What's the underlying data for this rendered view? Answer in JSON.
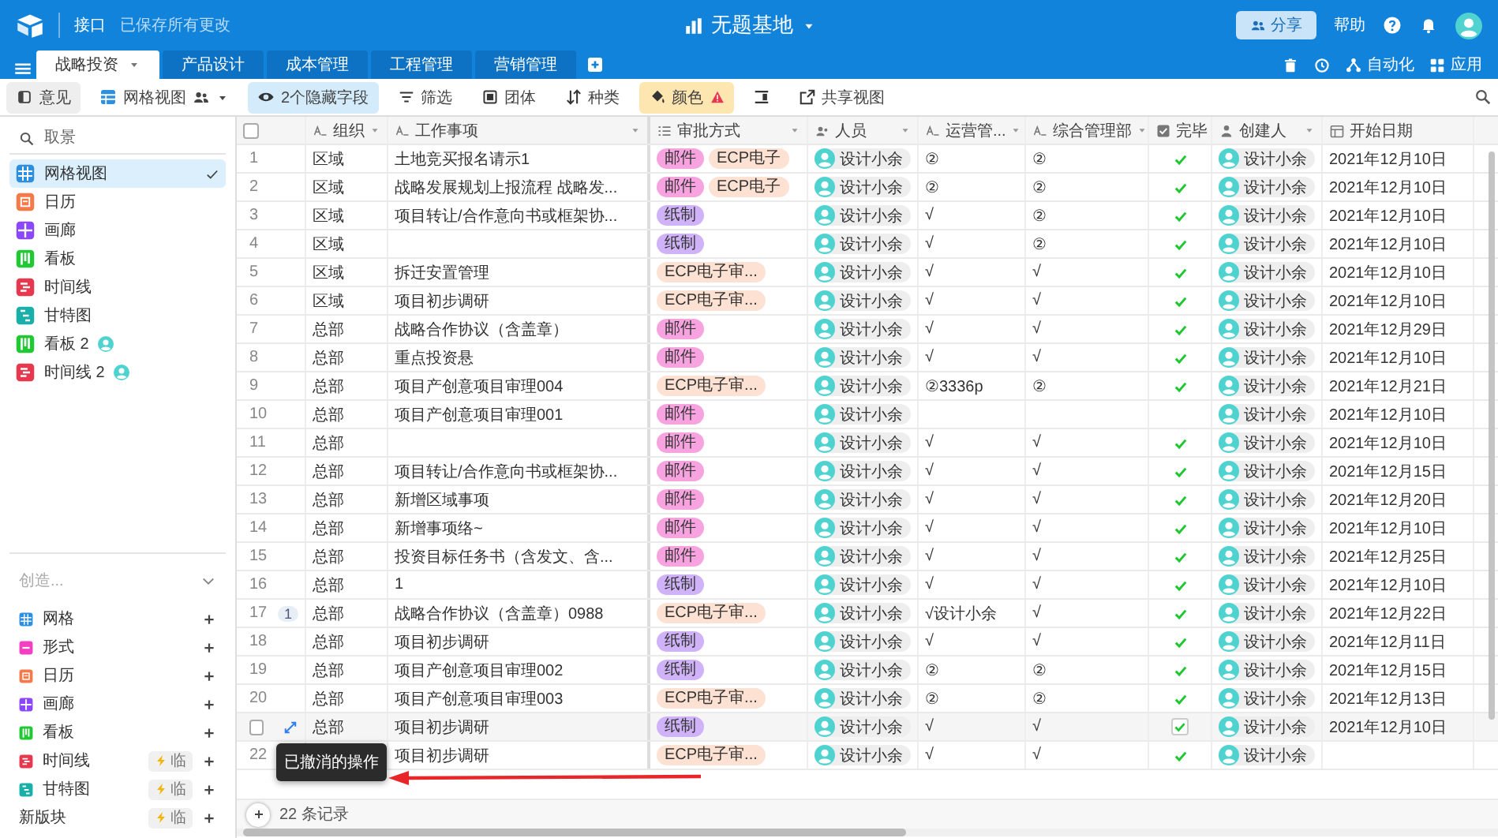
{
  "topbar": {
    "app_label": "接口",
    "save_status": "已保存所有更改",
    "base_title": "无题基地",
    "share_button": "分享",
    "help_label": "帮助"
  },
  "tabs": [
    {
      "label": "战略投资",
      "selected": true
    },
    {
      "label": "产品设计",
      "selected": false
    },
    {
      "label": "成本管理",
      "selected": false
    },
    {
      "label": "工程管理",
      "selected": false
    },
    {
      "label": "营销管理",
      "selected": false
    }
  ],
  "top_actions": [
    {
      "kind": "trash"
    },
    {
      "kind": "history"
    },
    {
      "kind": "automation",
      "label": "自动化"
    },
    {
      "kind": "apps",
      "label": "应用"
    }
  ],
  "toolbar": [
    {
      "kind": "feedback",
      "label": "意见"
    },
    {
      "kind": "view",
      "label": "网格视图"
    },
    {
      "kind": "hidden",
      "label": "2个隐藏字段"
    },
    {
      "kind": "filter",
      "label": "筛选"
    },
    {
      "kind": "group",
      "label": "团体"
    },
    {
      "kind": "sort",
      "label": "种类"
    },
    {
      "kind": "color",
      "label": "颜色"
    },
    {
      "kind": "rowheight"
    },
    {
      "kind": "share",
      "label": "共享视图"
    }
  ],
  "sidebar": {
    "search": {
      "placeholder": "取景"
    },
    "views": [
      {
        "kind": "grid",
        "label": "网格视图",
        "selected": true,
        "personal": false
      },
      {
        "kind": "calendar",
        "label": "日历",
        "selected": false,
        "personal": false
      },
      {
        "kind": "gallery",
        "label": "画廊",
        "selected": false,
        "personal": false
      },
      {
        "kind": "kanban",
        "label": "看板",
        "selected": false,
        "personal": false
      },
      {
        "kind": "timeline",
        "label": "时间线",
        "selected": false,
        "personal": false
      },
      {
        "kind": "gantt",
        "label": "甘特图",
        "selected": false,
        "personal": false
      },
      {
        "kind": "kanban",
        "label": "看板 2",
        "selected": false,
        "personal": true
      },
      {
        "kind": "timeline",
        "label": "时间线 2",
        "selected": false,
        "personal": true
      }
    ],
    "create": {
      "title": "创造...",
      "items": [
        {
          "kind": "grid",
          "label": "网格"
        },
        {
          "kind": "form",
          "label": "形式"
        },
        {
          "kind": "calendar",
          "label": "日历"
        },
        {
          "kind": "gallery",
          "label": "画廊"
        },
        {
          "kind": "kanban",
          "label": "看板"
        },
        {
          "kind": "timeline",
          "label": "时间线",
          "badge": "临"
        },
        {
          "kind": "gantt",
          "label": "甘特图",
          "badge": "临"
        },
        {
          "kind": "block",
          "label": "新版块",
          "badge": "临"
        }
      ]
    }
  },
  "grid": {
    "all_selected": false,
    "columns": [
      {
        "kind": "text",
        "label": "组织"
      },
      {
        "kind": "text",
        "label": "工作事项"
      },
      {
        "kind": "multi",
        "label": "审批方式"
      },
      {
        "kind": "user",
        "label": "人员"
      },
      {
        "kind": "text",
        "label": "运营管..."
      },
      {
        "kind": "text",
        "label": "综合管理部"
      },
      {
        "kind": "checkbox",
        "label": "完毕"
      },
      {
        "kind": "creator",
        "label": "创建人"
      },
      {
        "kind": "date",
        "label": "开始日期"
      }
    ],
    "rows": [
      {
        "number": "1",
        "hovered": false,
        "org": "区域",
        "item": "土地竞买报名请示1",
        "approvals": [
          {
            "label": "邮件",
            "color": "#f7a3e0"
          },
          {
            "label": "ECP电子",
            "color": "#fde1d3"
          }
        ],
        "person": "设计小余",
        "ops": "②",
        "mgmt": "②",
        "done": true,
        "creator": "设计小余",
        "date": "2021年12月10日"
      },
      {
        "number": "2",
        "hovered": false,
        "org": "区域",
        "item": "战略发展规划上报流程 战略发...",
        "approvals": [
          {
            "label": "邮件",
            "color": "#f7a3e0"
          },
          {
            "label": "ECP电子",
            "color": "#fde1d3"
          }
        ],
        "person": "设计小余",
        "ops": "②",
        "mgmt": "②",
        "done": true,
        "creator": "设计小余",
        "date": "2021年12月10日"
      },
      {
        "number": "3",
        "hovered": false,
        "org": "区域",
        "item": "项目转让/合作意向书或框架协...",
        "approvals": [
          {
            "label": "纸制",
            "color": "#cfb2f7"
          }
        ],
        "person": "设计小余",
        "ops": "√",
        "mgmt": "②",
        "done": true,
        "creator": "设计小余",
        "date": "2021年12月10日"
      },
      {
        "number": "4",
        "hovered": false,
        "org": "区域",
        "approvals": [
          {
            "label": "纸制",
            "color": "#cfb2f7"
          }
        ],
        "person": "设计小余",
        "ops": "√",
        "mgmt": "②",
        "done": true,
        "creator": "设计小余",
        "date": "2021年12月10日"
      },
      {
        "number": "5",
        "hovered": false,
        "org": "区域",
        "item": "拆迁安置管理",
        "approvals": [
          {
            "label": "ECP电子审...",
            "color": "#fde1d3"
          }
        ],
        "person": "设计小余",
        "ops": "√",
        "mgmt": "√",
        "done": true,
        "creator": "设计小余",
        "date": "2021年12月10日"
      },
      {
        "number": "6",
        "hovered": false,
        "org": "区域",
        "item": "项目初步调研",
        "approvals": [
          {
            "label": "ECP电子审...",
            "color": "#fde1d3"
          }
        ],
        "person": "设计小余",
        "ops": "√",
        "mgmt": "√",
        "done": true,
        "creator": "设计小余",
        "date": "2021年12月10日"
      },
      {
        "number": "7",
        "hovered": false,
        "org": "总部",
        "item": "战略合作协议（含盖章）",
        "approvals": [
          {
            "label": "邮件",
            "color": "#f7a3e0"
          }
        ],
        "person": "设计小余",
        "ops": "√",
        "mgmt": "√",
        "done": true,
        "creator": "设计小余",
        "date": "2021年12月29日"
      },
      {
        "number": "8",
        "hovered": false,
        "org": "总部",
        "item": "重点投资悬",
        "approvals": [
          {
            "label": "邮件",
            "color": "#f7a3e0"
          }
        ],
        "person": "设计小余",
        "ops": "√",
        "mgmt": "√",
        "done": true,
        "creator": "设计小余",
        "date": "2021年12月10日"
      },
      {
        "number": "9",
        "hovered": false,
        "org": "总部",
        "item": "项目产创意项目审理004",
        "approvals": [
          {
            "label": "ECP电子审...",
            "color": "#fde1d3"
          }
        ],
        "person": "设计小余",
        "ops": "②3336p",
        "mgmt": "②",
        "done": true,
        "creator": "设计小余",
        "date": "2021年12月21日"
      },
      {
        "number": "10",
        "hovered": false,
        "org": "总部",
        "item": "项目产创意项目审理001",
        "approvals": [
          {
            "label": "邮件",
            "color": "#f7a3e0"
          }
        ],
        "person": "设计小余",
        "done": false,
        "creator": "设计小余",
        "date": "2021年12月10日"
      },
      {
        "number": "11",
        "hovered": false,
        "org": "总部",
        "approvals": [
          {
            "label": "邮件",
            "color": "#f7a3e0"
          }
        ],
        "person": "设计小余",
        "ops": "√",
        "mgmt": "√",
        "done": true,
        "creator": "设计小余",
        "date": "2021年12月10日"
      },
      {
        "number": "12",
        "hovered": false,
        "org": "总部",
        "item": "项目转让/合作意向书或框架协...",
        "approvals": [
          {
            "label": "邮件",
            "color": "#f7a3e0"
          }
        ],
        "person": "设计小余",
        "ops": "√",
        "mgmt": "√",
        "done": true,
        "creator": "设计小余",
        "date": "2021年12月15日"
      },
      {
        "number": "13",
        "hovered": false,
        "org": "总部",
        "item": "新增区域事项",
        "approvals": [
          {
            "label": "邮件",
            "color": "#f7a3e0"
          }
        ],
        "person": "设计小余",
        "ops": "√",
        "mgmt": "√",
        "done": true,
        "creator": "设计小余",
        "date": "2021年12月20日"
      },
      {
        "number": "14",
        "hovered": false,
        "org": "总部",
        "item": "新增事项络~",
        "approvals": [
          {
            "label": "邮件",
            "color": "#f7a3e0"
          }
        ],
        "person": "设计小余",
        "ops": "√",
        "mgmt": "√",
        "done": true,
        "creator": "设计小余",
        "date": "2021年12月10日"
      },
      {
        "number": "15",
        "hovered": false,
        "org": "总部",
        "item": "投资目标任务书（含发文、含...",
        "approvals": [
          {
            "label": "邮件",
            "color": "#f7a3e0"
          }
        ],
        "person": "设计小余",
        "ops": "√",
        "mgmt": "√",
        "done": true,
        "creator": "设计小余",
        "date": "2021年12月25日"
      },
      {
        "number": "16",
        "hovered": false,
        "org": "总部",
        "item": "1",
        "approvals": [
          {
            "label": "纸制",
            "color": "#cfb2f7"
          }
        ],
        "person": "设计小余",
        "ops": "√",
        "mgmt": "√",
        "done": true,
        "creator": "设计小余",
        "date": "2021年12月10日"
      },
      {
        "number": "17",
        "hovered": false,
        "comments": "1",
        "org": "总部",
        "item": "战略合作协议（含盖章）0988",
        "approvals": [
          {
            "label": "ECP电子审...",
            "color": "#fde1d3"
          }
        ],
        "person": "设计小余",
        "ops": "√设计小余",
        "mgmt": "√",
        "done": true,
        "creator": "设计小余",
        "date": "2021年12月22日"
      },
      {
        "number": "18",
        "hovered": false,
        "org": "总部",
        "item": "项目初步调研",
        "approvals": [
          {
            "label": "纸制",
            "color": "#cfb2f7"
          }
        ],
        "person": "设计小余",
        "ops": "√",
        "mgmt": "√",
        "done": true,
        "creator": "设计小余",
        "date": "2021年12月11日"
      },
      {
        "number": "19",
        "hovered": false,
        "org": "总部",
        "item": "项目产创意项目审理002",
        "approvals": [
          {
            "label": "纸制",
            "color": "#cfb2f7"
          }
        ],
        "person": "设计小余",
        "ops": "②",
        "mgmt": "②",
        "done": true,
        "creator": "设计小余",
        "date": "2021年12月15日"
      },
      {
        "number": "20",
        "hovered": false,
        "org": "总部",
        "item": "项目产创意项目审理003",
        "approvals": [
          {
            "label": "ECP电子审...",
            "color": "#fde1d3"
          }
        ],
        "person": "设计小余",
        "ops": "②",
        "mgmt": "②",
        "done": true,
        "creator": "设计小余",
        "date": "2021年12月13日"
      },
      {
        "hovered": true,
        "org": "总部",
        "item": "项目初步调研",
        "approvals": [
          {
            "label": "纸制",
            "color": "#cfb2f7"
          }
        ],
        "person": "设计小余",
        "ops": "√",
        "mgmt": "√",
        "done": true,
        "creator": "设计小余",
        "date": "2021年12月10日"
      },
      {
        "number": "22",
        "hovered": false,
        "item": "项目初步调研",
        "approvals": [
          {
            "label": "ECP电子审...",
            "color": "#fde1d3"
          }
        ],
        "person": "设计小余",
        "ops": "√",
        "mgmt": "√",
        "done": true,
        "creator": "设计小余"
      }
    ],
    "record_count": "22 条记录",
    "toast": "已撤消的操作"
  }
}
